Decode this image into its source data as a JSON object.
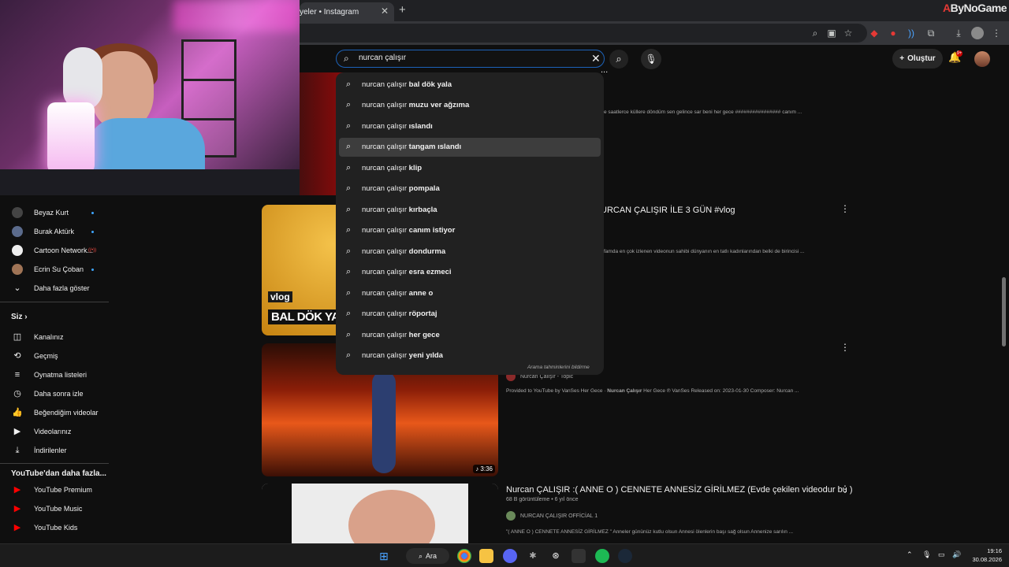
{
  "browser": {
    "tab_title": "yeler • Instagram",
    "tab_close": "✕",
    "new_tab": "+",
    "brand_mark": "A",
    "brand_text": "ByNoGame"
  },
  "youtube": {
    "search_value": "nurcan çalışır",
    "create_label": "Oluştur",
    "notification_count": "9+"
  },
  "suggestions": {
    "prefix": "nurcan çalışır ",
    "items": [
      {
        "rest": "bal dök yala"
      },
      {
        "rest": "muzu ver ağzıma"
      },
      {
        "rest": "ıslandı"
      },
      {
        "rest": "tangam ıslandı"
      },
      {
        "rest": "klip"
      },
      {
        "rest": "pompala"
      },
      {
        "rest": "kırbaçla"
      },
      {
        "rest": "canım istiyor"
      },
      {
        "rest": "dondurma"
      },
      {
        "rest": "esra ezmeci"
      },
      {
        "rest": "anne o"
      },
      {
        "rest": "röportaj"
      },
      {
        "rest": "her gece"
      },
      {
        "rest": "yeni yılda"
      }
    ],
    "active_index": 3,
    "report_label": "Arama tahminlerini bildirme"
  },
  "sidebar": {
    "subscriptions": [
      {
        "label": "Beyaz Kurt",
        "color": "#444444"
      },
      {
        "label": "Burak Aktürk",
        "color": "#5b6b8c"
      },
      {
        "label": "Cartoon Network...",
        "color": "#eeeeee",
        "live": "((•))"
      },
      {
        "label": "Ecrin Su Çoban",
        "color": "#a07456"
      }
    ],
    "show_more": "Daha fazla göster",
    "you_header": "Siz",
    "you_chevron": "›",
    "you_items": [
      {
        "label": "Kanalınız",
        "icon": "channel-icon"
      },
      {
        "label": "Geçmiş",
        "icon": "history-icon"
      },
      {
        "label": "Oynatma listeleri",
        "icon": "playlist-icon"
      },
      {
        "label": "Daha sonra izle",
        "icon": "clock-icon"
      },
      {
        "label": "Beğendiğim videolar",
        "icon": "like-icon"
      },
      {
        "label": "Videolarınız",
        "icon": "video-icon"
      },
      {
        "label": "İndirilenler",
        "icon": "download-icon"
      }
    ],
    "more_header": "YouTube'dan daha fazla...",
    "more_items": [
      {
        "label": "YouTube Premium"
      },
      {
        "label": "YouTube Music"
      },
      {
        "label": "YouTube Kids"
      }
    ]
  },
  "results": {
    "r1_title_partial": "...",
    "r1_desc": "e saatlerce küllere döndüm sen gelince sar beni her gece ################ canım ...",
    "r2_title": "URCAN ÇALIŞIR İLE 3 GÜN #vlog",
    "r2_desc": "famda en çok izlenen videonun sahibi dünyanın en tatlı kadınlarından belki de birincisi ...",
    "r2_thumb_tag": "vlog",
    "r2_thumb_title": "BAL DÖK YALA (",
    "r3_channel": "Nurcan Çalışır - Topic",
    "r3_desc_pre": "Provided to YouTube by VanSes Her Gece · ",
    "r3_desc_bold": "Nurcan Çalışır",
    "r3_desc_post": " Her Gece ℗ VanSes Released on: 2023-01-30 Composer: Nurcan ...",
    "r3_duration": "♪ 3:36",
    "r4_title": "Nurcan ÇALIŞIR :( ANNE O ) CENNETE ANNESİZ GİRİLMEZ (Evde çekilen videodur bu )",
    "r4_meta": "68 B görüntüleme • 6 yıl önce",
    "r4_channel": "NURCAN ÇALIŞIR OFFİCİAL 1",
    "r4_desc": "\"( ANNE O ) CENNETE ANNESİZ GİRİLMEZ \" Anneler gününüz kutlu olsun Annesi ölenlerin başı sağ olsun Annenize sarılın ..."
  },
  "taskbar": {
    "search_label": "Ara",
    "time": "19:16",
    "date": "30.08.2026"
  },
  "colors": {
    "accent": "#1c62b9",
    "youtube_red": "#ff0000",
    "background": "#0f0f0f"
  }
}
